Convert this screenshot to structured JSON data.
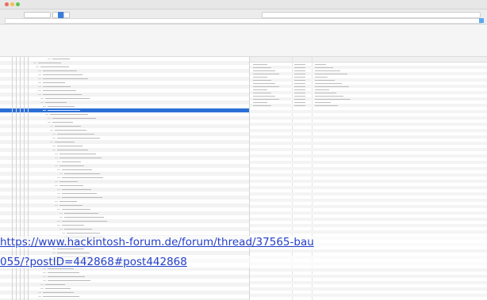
{
  "link": {
    "line1": "https://www.hackintosh-forum.de/forum/thread/37565-bau",
    "line2": "055/?postID=442868#post442868"
  }
}
